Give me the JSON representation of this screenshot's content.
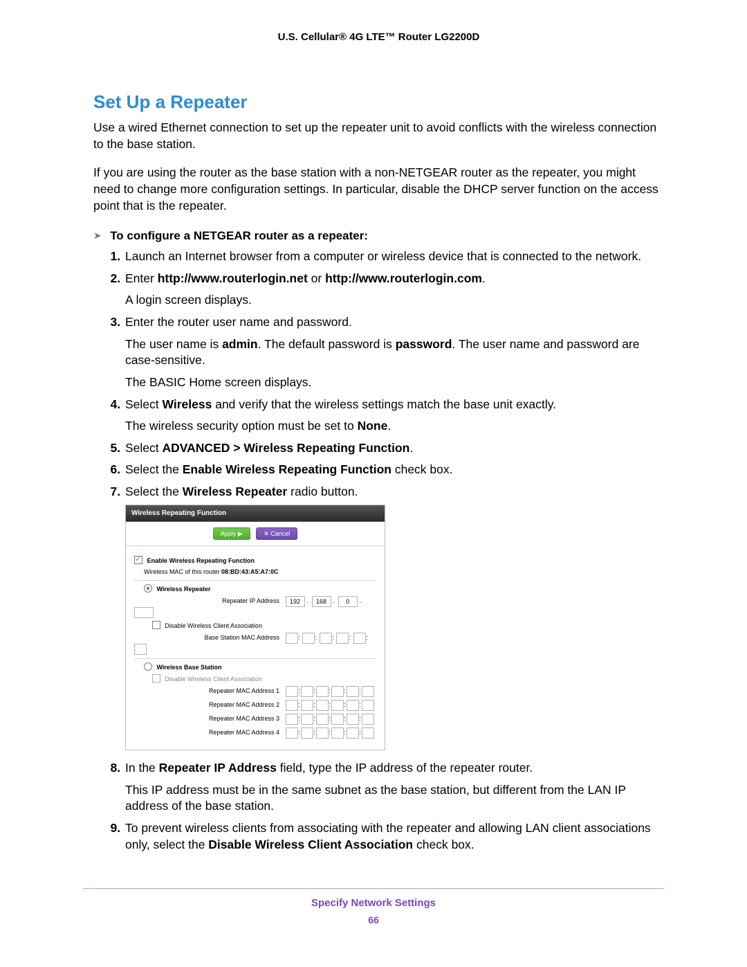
{
  "header": "U.S. Cellular® 4G LTE™ Router LG2200D",
  "section_title": "Set Up a Repeater",
  "intro1": "Use a wired Ethernet connection to set up the repeater unit to avoid conflicts with the wireless connection to the base station.",
  "intro2": "If you are using the router as the base station with a non-NETGEAR router as the repeater, you might need to change more configuration settings. In particular, disable the DHCP server function on the access point that is the repeater.",
  "task_heading": "To configure a NETGEAR router as a repeater:",
  "steps": {
    "s1": "Launch an Internet browser from a computer or wireless device that is connected to the network.",
    "s2_a": "Enter ",
    "s2_b": "http://www.routerlogin.net",
    "s2_c": " or ",
    "s2_d": "http://www.routerlogin.com",
    "s2_e": ".",
    "s2_p": "A login screen displays.",
    "s3": "Enter the router user name and password.",
    "s3_p1a": "The user name is ",
    "s3_p1b": "admin",
    "s3_p1c": ". The default password is ",
    "s3_p1d": "password",
    "s3_p1e": ". The user name and password are case-sensitive.",
    "s3_p2": "The BASIC Home screen displays.",
    "s4_a": "Select ",
    "s4_b": "Wireless",
    "s4_c": " and verify that the wireless settings match the base unit exactly.",
    "s4_p_a": "The wireless security option must be set to ",
    "s4_p_b": "None",
    "s4_p_c": ".",
    "s5_a": "Select ",
    "s5_b": "ADVANCED > Wireless Repeating Function",
    "s5_c": ".",
    "s6_a": "Select the ",
    "s6_b": "Enable Wireless Repeating Function",
    "s6_c": " check box.",
    "s7_a": "Select the ",
    "s7_b": "Wireless Repeater",
    "s7_c": " radio button.",
    "s8_a": "In the ",
    "s8_b": "Repeater IP Address",
    "s8_c": " field, type the IP address of the repeater router.",
    "s8_p": "This IP address must be in the same subnet as the base station, but different from the LAN IP address of the base station.",
    "s9_a": "To prevent wireless clients from associating with the repeater and allowing LAN client associations only, select the ",
    "s9_b": "Disable Wireless Client Association",
    "s9_c": " check box."
  },
  "figure": {
    "title": "Wireless Repeating Function",
    "apply": "Apply ▶",
    "cancel": "✕ Cancel",
    "enable_label": "Enable Wireless Repeating Function",
    "mac_line_a": "Wireless MAC of this router ",
    "mac_line_b": "08:BD:43:A5:A7:0C",
    "wr_label": "Wireless Repeater",
    "repeater_ip_label": "Repeater IP Address",
    "ip": [
      "192",
      "168",
      "0",
      ""
    ],
    "disable_assoc": "Disable Wireless Client Association",
    "base_mac_label": "Base Station MAC Address",
    "wbs_label": "Wireless Base Station",
    "disable_assoc2": "Disable Wireless Client Association",
    "rmac1": "Repeater MAC Address 1",
    "rmac2": "Repeater MAC Address 2",
    "rmac3": "Repeater MAC Address 3",
    "rmac4": "Repeater MAC Address 4"
  },
  "footer_title": "Specify Network Settings",
  "footer_page": "66"
}
